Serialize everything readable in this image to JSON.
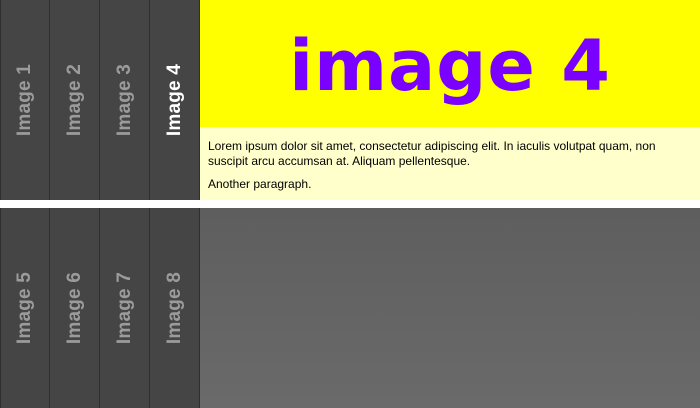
{
  "tabs_top": [
    {
      "label": "Image 1"
    },
    {
      "label": "Image 2"
    },
    {
      "label": "Image 3"
    },
    {
      "label": "Image 4",
      "active": true
    }
  ],
  "tabs_bottom": [
    {
      "label": "Image 5"
    },
    {
      "label": "Image 6"
    },
    {
      "label": "Image 7"
    },
    {
      "label": "Image 8"
    }
  ],
  "hero": {
    "title": "image 4"
  },
  "content": {
    "paragraph1": "Lorem ipsum dolor sit amet, consectetur adipiscing elit. In iaculis volutpat quam, non suscipit arcu accumsan at. Aliquam pellentesque.",
    "paragraph2": "Another paragraph."
  },
  "colors": {
    "tab_bg": "#454545",
    "hero_bg": "#ffff00",
    "hero_text": "#7a00ff",
    "text_bg": "#ffffcc"
  }
}
